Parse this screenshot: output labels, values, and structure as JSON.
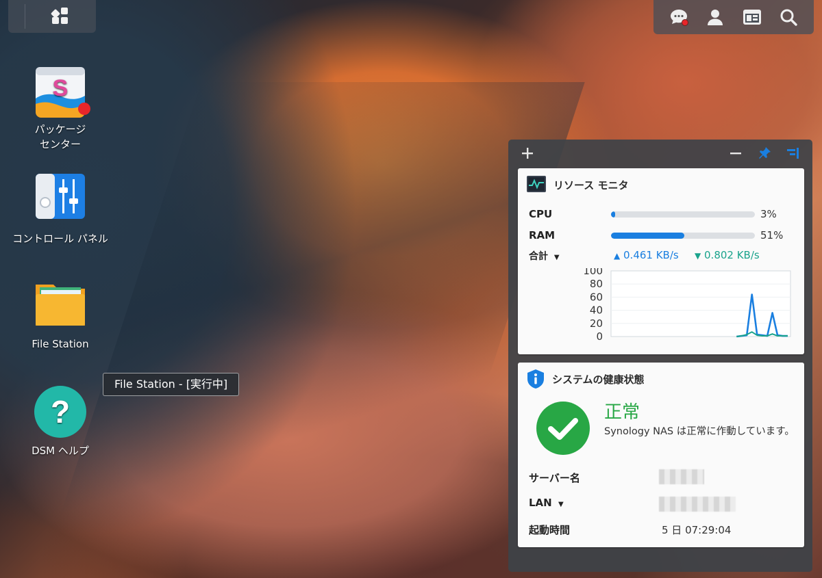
{
  "desktop": {
    "icons": [
      {
        "label_line1": "パッケージ",
        "label_line2": "センター",
        "icon": "package-center-icon"
      },
      {
        "label": "コントロール パネル",
        "icon": "control-panel-icon"
      },
      {
        "label": "File Station",
        "icon": "file-station-icon"
      },
      {
        "label": "DSM ヘルプ",
        "icon": "dsm-help-icon"
      }
    ],
    "tooltip": "File Station - [実行中]"
  },
  "taskbar": {
    "left_icon": "main-menu-icon",
    "right_icons": [
      "notifications-icon",
      "user-icon",
      "widgets-icon",
      "search-icon"
    ]
  },
  "widgets": {
    "toolbar": {
      "add": "+",
      "minimize": "−"
    },
    "resource_monitor": {
      "title": "リソース モニタ",
      "cpu_label": "CPU",
      "cpu_pct": 3,
      "cpu_pct_text": "3%",
      "ram_label": "RAM",
      "ram_pct": 51,
      "ram_pct_text": "51%",
      "net_label": "合計",
      "upload": "0.461 KB/s",
      "download": "0.802 KB/s"
    },
    "health": {
      "title": "システムの健康状態",
      "status": "正常",
      "description": "Synology NAS は正常に作動しています。",
      "server_name_label": "サーバー名",
      "lan_label": "LAN",
      "uptime_label": "起動時間",
      "uptime_value": "5 日 07:29:04"
    }
  },
  "colors": {
    "accent_blue": "#1a7fe0",
    "teal": "#1aa38c",
    "ok_green": "#28a745",
    "badge_red": "#e8262a"
  },
  "chart_data": {
    "type": "line",
    "yticks": [
      "100",
      "80",
      "60",
      "40",
      "20",
      "0"
    ],
    "ylim": [
      0,
      100
    ],
    "series": [
      {
        "values": [
          0,
          0,
          0,
          0,
          0,
          0,
          0,
          0,
          0,
          0,
          0,
          0,
          0,
          0,
          0,
          0,
          0,
          0,
          0,
          0,
          0,
          0,
          0,
          0,
          0,
          1,
          2,
          64,
          3,
          2,
          1,
          36,
          2,
          1,
          1
        ]
      },
      {
        "values": [
          0,
          0,
          0,
          0,
          0,
          0,
          0,
          0,
          0,
          0,
          0,
          0,
          0,
          0,
          0,
          0,
          0,
          0,
          0,
          0,
          0,
          0,
          0,
          0,
          0,
          1,
          3,
          7,
          2,
          1,
          1,
          4,
          1,
          1,
          1
        ]
      }
    ]
  }
}
